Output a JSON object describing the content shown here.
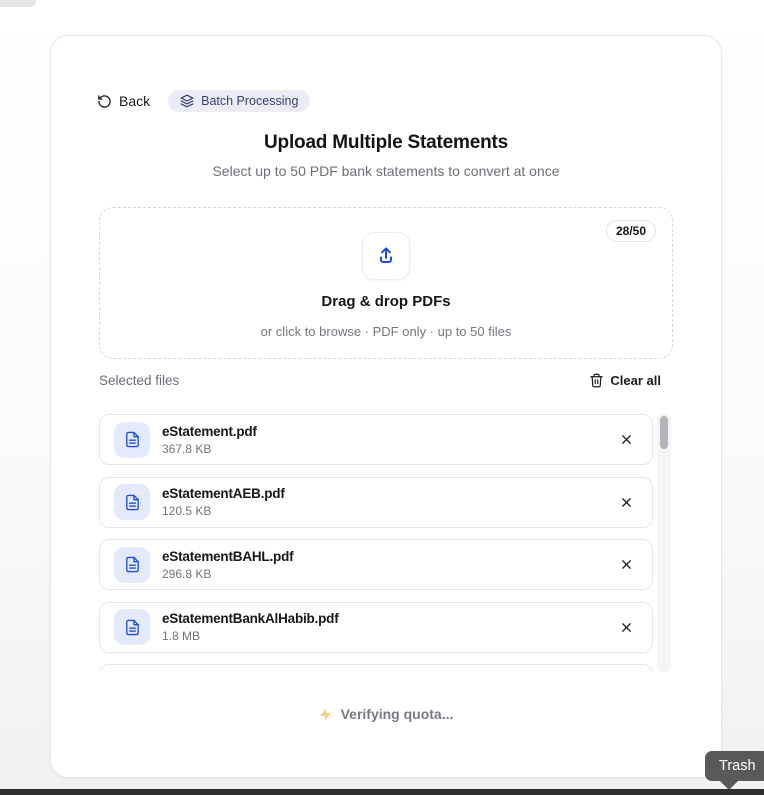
{
  "header": {
    "back_label": "Back",
    "badge_label": "Batch Processing",
    "title": "Upload Multiple Statements",
    "subtitle": "Select up to 50 PDF bank statements to convert at once"
  },
  "dropzone": {
    "count": "28/50",
    "heading": "Drag & drop PDFs",
    "hint": "or click to browse · PDF only · up to 50 files"
  },
  "files": {
    "section_label": "Selected files",
    "clear_all_label": "Clear all",
    "items": [
      {
        "name": "eStatement.pdf",
        "size": "367.8 KB"
      },
      {
        "name": "eStatementAEB.pdf",
        "size": "120.5 KB"
      },
      {
        "name": "eStatementBAHL.pdf",
        "size": "296.8 KB"
      },
      {
        "name": "eStatementBankAlHabib.pdf",
        "size": "1.8 MB"
      }
    ]
  },
  "footer": {
    "status": "Verifying quota..."
  },
  "tooltip": {
    "label": "Trash"
  },
  "colors": {
    "badge-bg": "#ebecf6",
    "badge-text": "#3c3d6e",
    "accent-blue": "#1d4ed8",
    "fileicon-bg": "#e4eafb",
    "zap": "#f3c867"
  }
}
